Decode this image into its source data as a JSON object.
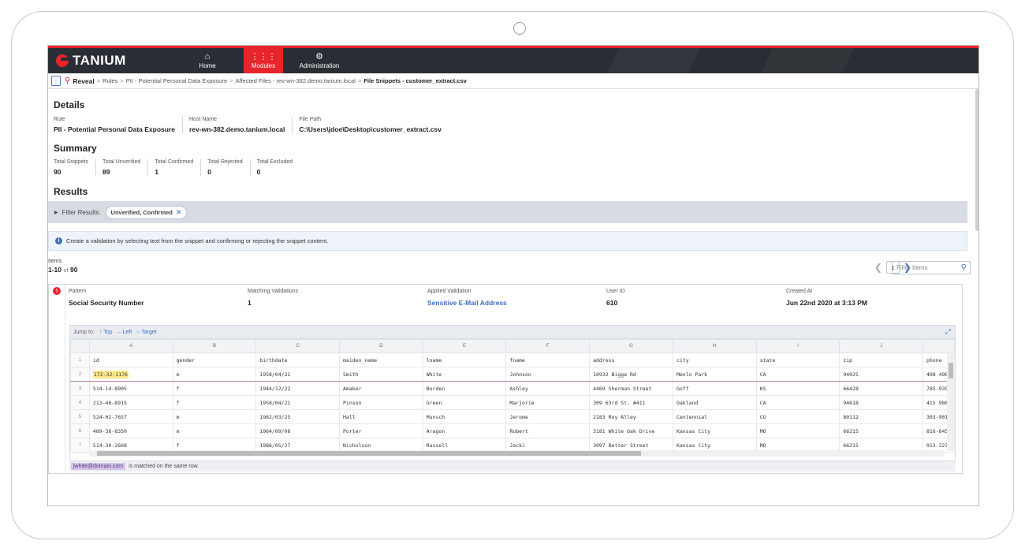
{
  "nav": {
    "brand": "TANIUM",
    "items": [
      {
        "label": "Home",
        "icon": "home-icon"
      },
      {
        "label": "Modules",
        "icon": "grid-icon"
      },
      {
        "label": "Administration",
        "icon": "gear-icon"
      }
    ]
  },
  "breadcrumb": {
    "module": "Reveal",
    "crumbs": [
      "Rules",
      "PII - Potential Personal Data Exposure",
      "Affected Files - rev-wn-382.demo.tanium.local"
    ],
    "current": "File Snippets - customer_extract.csv"
  },
  "details": {
    "title": "Details",
    "rule_label": "Rule",
    "rule": "PII - Potential Personal Data Exposure",
    "host_label": "Host Name",
    "host": "rev-wn-382.demo.tanium.local",
    "path_label": "File Path",
    "path": "C:\\Users\\jdoe\\Desktop\\customer_extract.csv"
  },
  "summary": {
    "title": "Summary",
    "stats": [
      {
        "label": "Total Snippets",
        "value": "90"
      },
      {
        "label": "Total Unverified",
        "value": "89"
      },
      {
        "label": "Total Confirmed",
        "value": "1"
      },
      {
        "label": "Total Rejected",
        "value": "0"
      },
      {
        "label": "Total Excluded",
        "value": "0"
      }
    ]
  },
  "results": {
    "title": "Results",
    "filter_label": "Filter Results:",
    "filter_chip": "Unverified, Confirmed",
    "info": "Create a validation by selecting text from the snippet and confirming or rejecting the snippet content.",
    "items_label": "Items",
    "items_range": "1-10",
    "items_of": "of",
    "items_total": "90",
    "page": "1",
    "filter_placeholder": "Filter Items"
  },
  "card": {
    "pattern_label": "Pattern",
    "pattern": "Social Security Number",
    "matching_label": "Matching Validations",
    "matching": "1",
    "applied_label": "Applied Validation",
    "applied": "Sensitive E-Mail Address",
    "user_label": "User ID",
    "user": "610",
    "created_label": "Created At",
    "created": "Jun 22nd 2020 at 3:13 PM"
  },
  "snippet": {
    "jump_label": "Jump to:",
    "jump_top": "Top",
    "jump_left": "Left",
    "jump_target": "Target",
    "columns": [
      "A",
      "B",
      "C",
      "D",
      "E",
      "F",
      "G",
      "H",
      "I",
      "J",
      ""
    ],
    "rows": [
      [
        "1",
        "id",
        "gender",
        "birthdate",
        "maiden_name",
        "lname",
        "fname",
        "address",
        "city",
        "state",
        "zip",
        "phone"
      ],
      [
        "2",
        "172-32-1176",
        "m",
        "1958/04/21",
        "Smith",
        "White",
        "Johnson",
        "10932 Bigge Rd",
        "Menlo Park",
        "CA",
        "94025",
        "408 496-"
      ],
      [
        "3",
        "514-14-8905",
        "f",
        "1944/12/22",
        "Amaker",
        "Borden",
        "Ashley",
        "4469 Sherman Street",
        "Goff",
        "KS",
        "66428",
        "785-939-"
      ],
      [
        "4",
        "213-46-8915",
        "f",
        "1958/04/21",
        "Pinson",
        "Green",
        "Marjorie",
        "309 63rd St. #411",
        "Oakland",
        "CA",
        "94618",
        "415 986-"
      ],
      [
        "5",
        "524-02-7657",
        "m",
        "1962/03/25",
        "Hall",
        "Munsch",
        "Jerome",
        "2183 Roy Alley",
        "Centennial",
        "CO",
        "80112",
        "303-901-"
      ],
      [
        "6",
        "489-36-8350",
        "m",
        "1964/09/06",
        "Porter",
        "Aragon",
        "Robert",
        "3181 White Oak Drive",
        "Kansas City",
        "MO",
        "66215",
        "816-645-"
      ],
      [
        "7",
        "514-30-2668",
        "f",
        "1986/05/27",
        "Nicholson",
        "Russell",
        "Jacki",
        "3097 Better Street",
        "Kansas City",
        "MO",
        "66215",
        "913-227-"
      ]
    ],
    "match_email": "jwhite@domain.com",
    "match_text": "is matched on the same row."
  }
}
